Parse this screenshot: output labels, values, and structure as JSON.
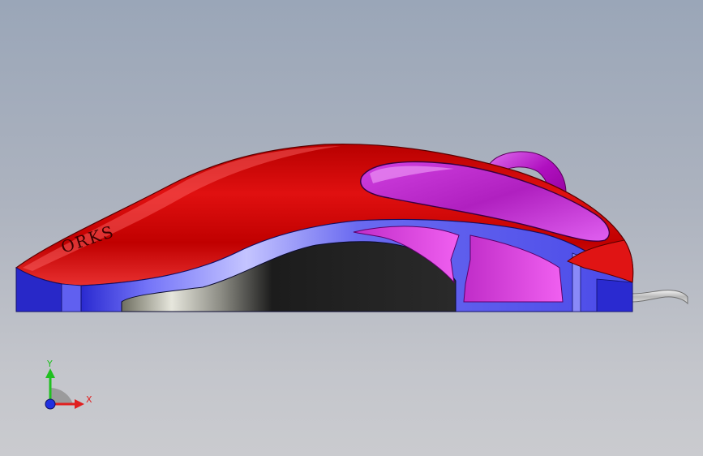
{
  "viewport": {
    "background_top": "#9aa6b8",
    "background_bottom": "#cacbcf"
  },
  "model": {
    "embossed_text": "ORKS",
    "colors": {
      "shell": "#d40000",
      "shell_highlight": "#ff5a5a",
      "side_panel": "#5050f0",
      "side_panel_light": "#b3b3ff",
      "inset": "#d23cd8",
      "inset_light": "#f560f0",
      "button": "#b02cc0",
      "wheel": "#c020d0",
      "grip": "#1e1e1e",
      "cable": "#dcdcdc"
    }
  },
  "triad": {
    "x_label": "X",
    "y_label": "Y",
    "x_color": "#e02020",
    "y_color": "#20c020",
    "z_color": "#2030e0"
  }
}
